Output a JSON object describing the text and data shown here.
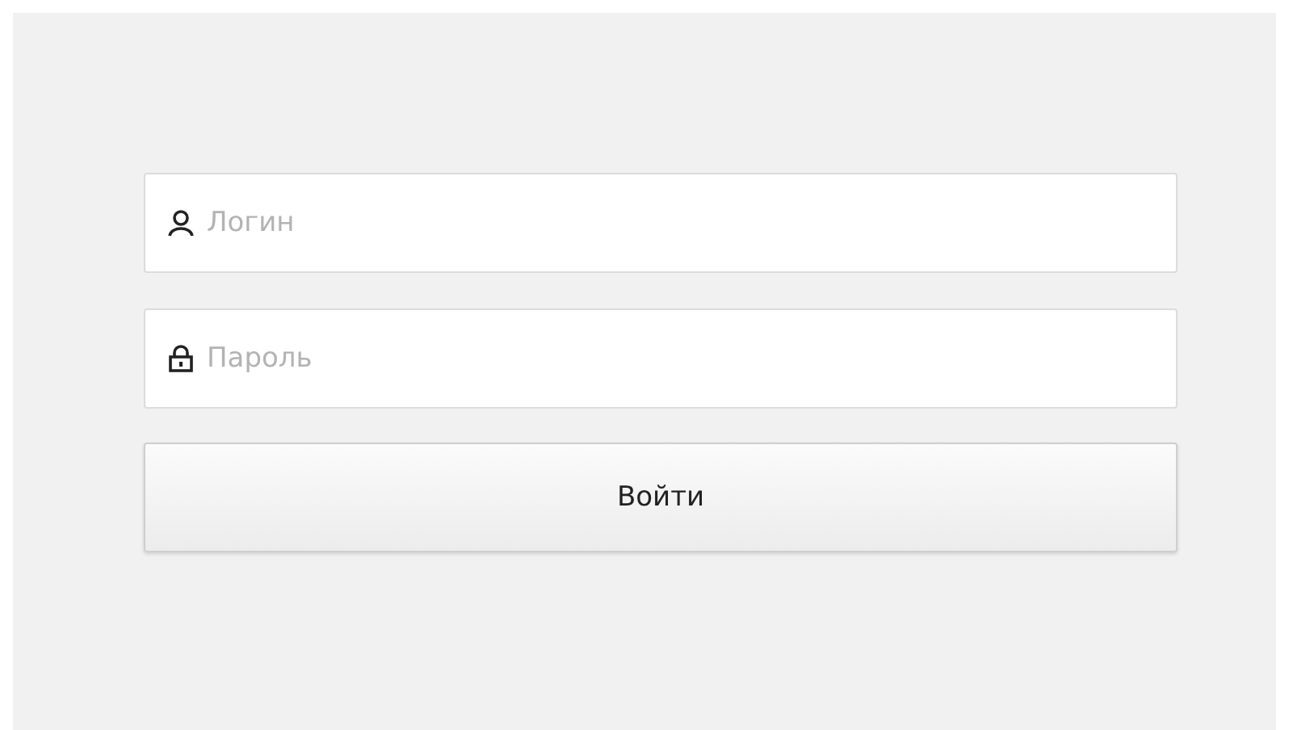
{
  "login_form": {
    "fields": [
      {
        "kind": "user",
        "placeholder": "Логин"
      },
      {
        "kind": "lock",
        "placeholder": "Пароль"
      }
    ],
    "submit_button": {
      "label": "Войти"
    }
  }
}
